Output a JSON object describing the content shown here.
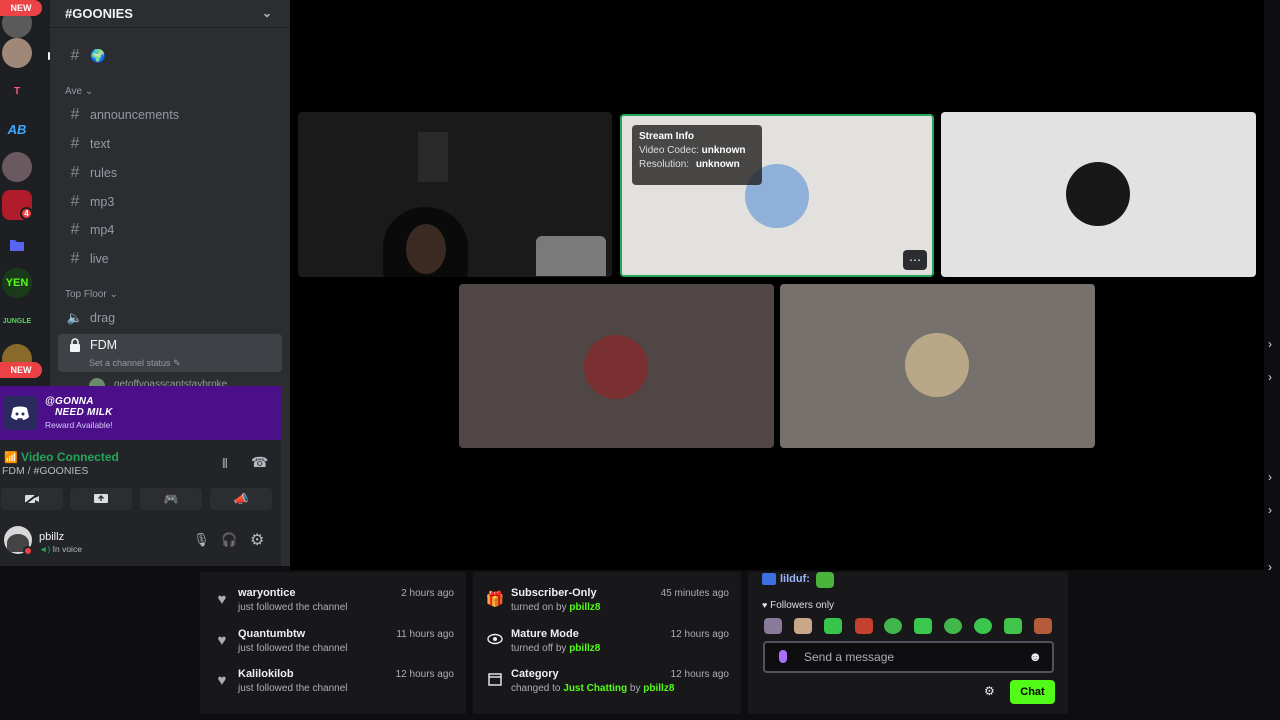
{
  "server": {
    "name": "#GOONIES"
  },
  "rail": {
    "new_top": "NEW",
    "new_bottom": "NEW",
    "badge_count": "4",
    "letter_t": "T",
    "text_ab": "AB"
  },
  "channels": {
    "top_emoji": "🌍",
    "category_ave": "Ave",
    "category_top_floor": "Top Floor",
    "items": [
      {
        "name": "announcements"
      },
      {
        "name": "text"
      },
      {
        "name": "rules"
      },
      {
        "name": "mp3"
      },
      {
        "name": "mp4"
      },
      {
        "name": "live"
      }
    ],
    "voice_channel": "drag",
    "locked_channel": "FDM",
    "locked_status": "Set a channel status",
    "member_cut": "getoffyoasscantstaybroke"
  },
  "reward": {
    "line1": "@GONNA",
    "line2": "NEED MILK",
    "line3": "Reward Available!"
  },
  "voice": {
    "status": "Video Connected",
    "location": "FDM / #GOONIES"
  },
  "user": {
    "name": "pbillz",
    "status": "In voice"
  },
  "stream_info": {
    "title": "Stream Info",
    "codec_label": "Video Codec:",
    "codec_value": "unknown",
    "res_label": "Resolution:",
    "res_value": "unknown"
  },
  "activity_col1": [
    {
      "title": "waryontice",
      "sub": "just followed the channel",
      "time": "2 hours ago"
    },
    {
      "title": "Quantumbtw",
      "sub": "just followed the channel",
      "time": "11 hours ago"
    },
    {
      "title": "Kalilokilob",
      "sub": "just followed the channel",
      "time": "12 hours ago"
    }
  ],
  "activity_col2": [
    {
      "title": "Subscriber-Only",
      "sub_pre": "turned on by ",
      "user": "pbillz8",
      "time": "45 minutes ago"
    },
    {
      "title": "Mature Mode",
      "sub_pre": "turned off by ",
      "user": "pbillz8",
      "time": "12 hours ago"
    },
    {
      "title": "Category",
      "sub_pre": "changed to ",
      "mid": "Just Chatting",
      "sub_by": " by ",
      "user": "pbillz8",
      "time": "12 hours ago"
    }
  ],
  "chat": {
    "top_user": "lilduf:",
    "mode": "Followers only",
    "placeholder": "Send a message",
    "chat_button": "Chat"
  },
  "colors": {
    "discord_green": "#23a55a",
    "twitch_green": "#53fc18",
    "reward_purple": "#4b0f8a",
    "speaking_border": "#23a55a"
  }
}
